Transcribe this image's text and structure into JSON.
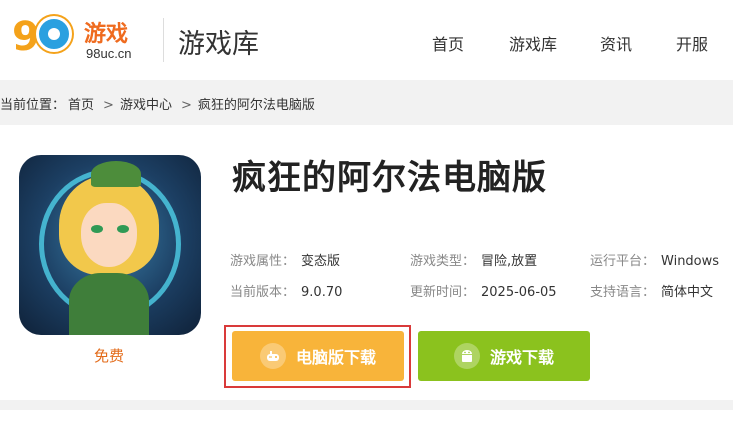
{
  "header": {
    "logo_brand": "游戏",
    "logo_domain": "98uc.cn",
    "logo_number": "98",
    "section_title": "游戏库",
    "nav": [
      "首页",
      "游戏库",
      "资讯",
      "开服"
    ]
  },
  "breadcrumb": {
    "prefix": "当前位置：",
    "items": [
      "首页",
      "游戏中心",
      "疯狂的阿尔法电脑版"
    ]
  },
  "game": {
    "title": "疯狂的阿尔法电脑版",
    "price_tag": "免费",
    "attributes": [
      {
        "label": "游戏属性：",
        "value": "变态版"
      },
      {
        "label": "游戏类型：",
        "value": "冒险,放置"
      },
      {
        "label": "运行平台：",
        "value": "Windows"
      },
      {
        "label": "当前版本：",
        "value": "9.0.70"
      },
      {
        "label": "更新时间：",
        "value": "2025-06-05"
      },
      {
        "label": "支持语言：",
        "value": "简体中文"
      }
    ]
  },
  "buttons": {
    "pc_download": "电脑版下载",
    "game_download": "游戏下载"
  },
  "colors": {
    "pc_button": "#f8b43a",
    "game_button": "#8bc21e",
    "highlight": "#d93a3a",
    "free_text": "#e36b1a"
  }
}
